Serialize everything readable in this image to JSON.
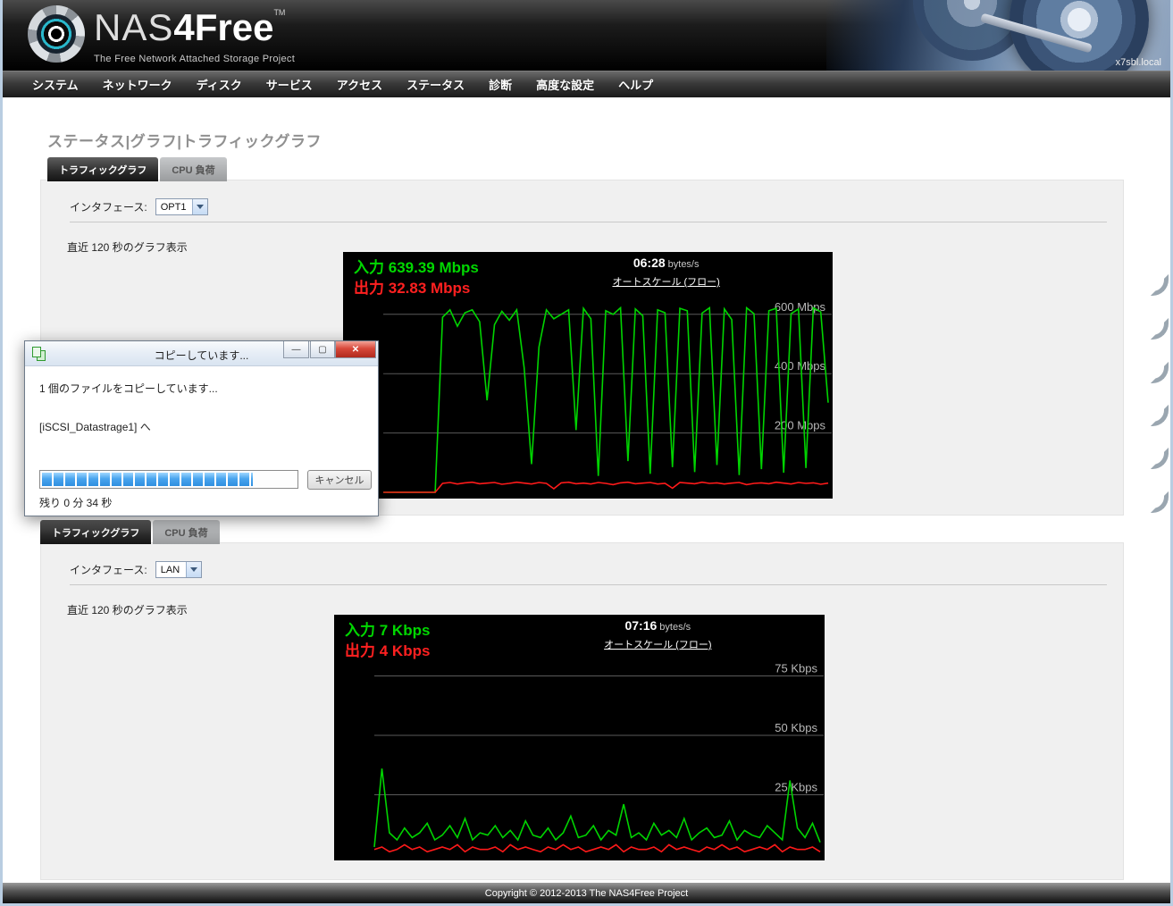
{
  "header": {
    "brand_prefix": "NAS",
    "brand_suffix": "4Free",
    "brand_tm": "TM",
    "tagline": "The Free Network Attached Storage Project",
    "hostname": "x7sbl.local"
  },
  "nav": {
    "items": [
      "システム",
      "ネットワーク",
      "ディスク",
      "サービス",
      "アクセス",
      "ステータス",
      "診断",
      "高度な設定",
      "ヘルプ"
    ]
  },
  "breadcrumb": "ステータス|グラフ|トラフィックグラフ",
  "panels": [
    {
      "tabs": [
        {
          "label": "トラフィックグラフ"
        },
        {
          "label": "CPU 負荷"
        }
      ],
      "interface_label": "インタフェース:",
      "interface_value": "OPT1",
      "caption": "直近 120 秒のグラフ表示"
    },
    {
      "tabs": [
        {
          "label": "トラフィックグラフ"
        },
        {
          "label": "CPU 負荷"
        }
      ],
      "interface_label": "インタフェース:",
      "interface_value": "LAN",
      "caption": "直近 120 秒のグラフ表示"
    }
  ],
  "chart_data": [
    {
      "type": "line",
      "title": "OPT1 traffic, last 120 seconds",
      "in_label": "入力",
      "in_value": "639.39 Mbps",
      "out_label": "出力",
      "out_value": "32.83 Mbps",
      "time": "06:28",
      "unit": "bytes/s",
      "autoscale_label": "オートスケール (フロー)",
      "ylim": [
        0,
        780
      ],
      "gridlines": [
        {
          "value": 600,
          "label": "600 Mbps"
        },
        {
          "value": 400,
          "label": "400 Mbps"
        },
        {
          "value": 200,
          "label": "200 Mbps"
        }
      ],
      "series": [
        {
          "name": "in",
          "color": "#00d400",
          "values": [
            0,
            0,
            0,
            0,
            0,
            0,
            0,
            0,
            590,
            615,
            560,
            605,
            615,
            575,
            310,
            565,
            610,
            580,
            615,
            420,
            95,
            490,
            615,
            585,
            600,
            615,
            210,
            620,
            585,
            55,
            612,
            600,
            622,
            105,
            618,
            595,
            62,
            615,
            605,
            85,
            620,
            612,
            68,
            604,
            622,
            92,
            618,
            582,
            58,
            622,
            602,
            78,
            612,
            620,
            66,
            602,
            618,
            82,
            622,
            608,
            302
          ]
        },
        {
          "name": "out",
          "color": "#ff1a1a",
          "values": [
            0,
            0,
            0,
            0,
            0,
            0,
            0,
            0,
            30,
            33,
            28,
            32,
            34,
            29,
            31,
            33,
            27,
            30,
            34,
            31,
            28,
            33,
            30,
            12,
            32,
            34,
            29,
            31,
            28,
            33,
            30,
            26,
            32,
            34,
            29,
            31,
            33,
            28,
            30,
            14,
            33,
            31,
            29,
            34,
            30,
            32,
            28,
            31,
            33,
            26,
            30,
            32,
            29,
            34,
            31,
            28,
            33,
            30,
            32,
            27,
            31
          ]
        }
      ]
    },
    {
      "type": "line",
      "title": "LAN traffic, last 120 seconds",
      "in_label": "入力",
      "in_value": "7 Kbps",
      "out_label": "出力",
      "out_value": "4 Kbps",
      "time": "07:16",
      "unit": "bytes/s",
      "autoscale_label": "オートスケール (フロー)",
      "ylim": [
        0,
        97
      ],
      "gridlines": [
        {
          "value": 75,
          "label": "75 Kbps"
        },
        {
          "value": 50,
          "label": "50 Kbps"
        },
        {
          "value": 25,
          "label": "25 Kbps"
        }
      ],
      "series": [
        {
          "name": "in",
          "color": "#00d400",
          "values": [
            3,
            36,
            9,
            6,
            11,
            7,
            9,
            13,
            6,
            8,
            12,
            7,
            15,
            6,
            9,
            8,
            12,
            7,
            10,
            6,
            14,
            8,
            7,
            11,
            6,
            9,
            16,
            7,
            8,
            12,
            6,
            10,
            8,
            21,
            7,
            9,
            6,
            13,
            8,
            10,
            7,
            15,
            6,
            9,
            11,
            7,
            8,
            14,
            6,
            10,
            8,
            7,
            12,
            9,
            6,
            31,
            11,
            7,
            13,
            5
          ]
        },
        {
          "name": "out",
          "color": "#ff1a1a",
          "values": [
            2,
            3,
            1,
            2,
            4,
            2,
            3,
            1,
            2,
            3,
            2,
            4,
            1,
            3,
            2,
            2,
            3,
            1,
            4,
            2,
            3,
            2,
            1,
            3,
            2,
            4,
            2,
            3,
            1,
            2,
            3,
            2,
            4,
            1,
            3,
            2,
            2,
            3,
            1,
            4,
            2,
            3,
            2,
            1,
            3,
            2,
            4,
            2,
            3,
            1,
            2,
            3,
            2,
            4,
            1,
            3,
            2,
            2,
            3,
            1
          ]
        }
      ]
    }
  ],
  "dialog": {
    "title": "コピーしています...",
    "message": "1 個のファイルをコピーしています...",
    "destination": "[iSCSI_Datastrage1] へ",
    "cancel_label": "キャンセル",
    "remaining": "残り 0 分 34 秒",
    "progress_percent": 83,
    "controls": {
      "minimize": "—",
      "maximize": "▢",
      "close": "✕"
    }
  },
  "footer": {
    "copyright": "Copyright © 2012-2013 The NAS4Free Project"
  }
}
